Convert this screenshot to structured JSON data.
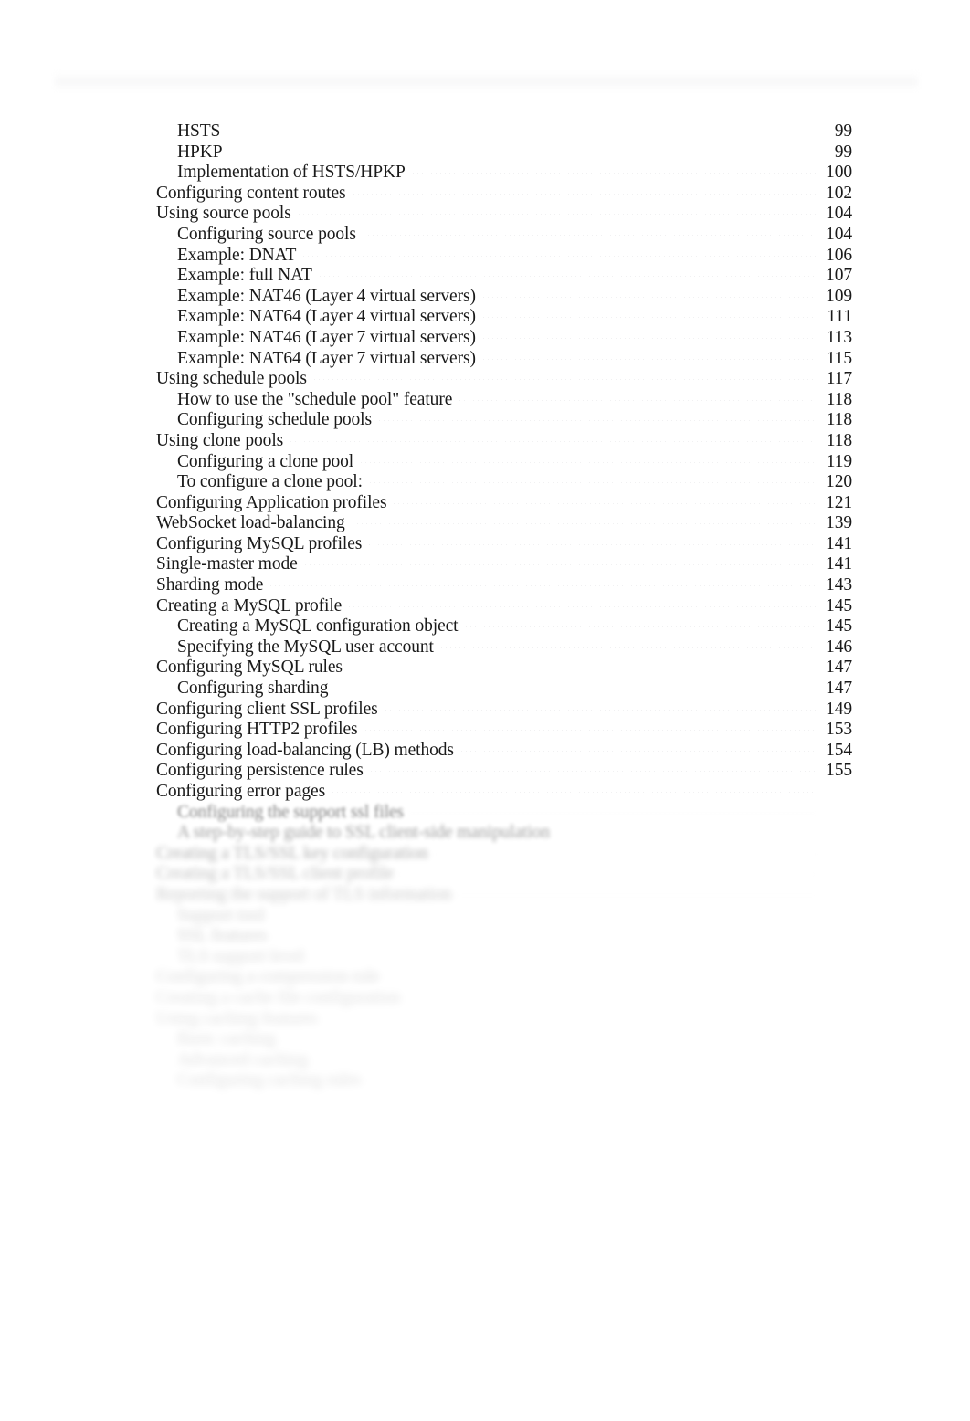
{
  "document": {
    "type": "table-of-contents",
    "running_header": "",
    "background_color": "#ffffff",
    "text_color": "#1a1a1a",
    "leader_dot_color": "#f1f1f2"
  },
  "toc": {
    "entries": [
      {
        "label": "HSTS",
        "page": "99",
        "level": 2,
        "blur": 0
      },
      {
        "label": "HPKP",
        "page": "99",
        "level": 2,
        "blur": 0
      },
      {
        "label": "Implementation of HSTS/HPKP",
        "page": "100",
        "level": 2,
        "blur": 0
      },
      {
        "label": "Configuring content routes",
        "page": "102",
        "level": 1,
        "blur": 0
      },
      {
        "label": "Using source pools",
        "page": "104",
        "level": 1,
        "blur": 0
      },
      {
        "label": "Configuring source pools",
        "page": "104",
        "level": 2,
        "blur": 0
      },
      {
        "label": "Example: DNAT",
        "page": "106",
        "level": 2,
        "blur": 0
      },
      {
        "label": "Example: full NAT",
        "page": "107",
        "level": 2,
        "blur": 0
      },
      {
        "label": "Example: NAT46 (Layer 4 virtual servers)",
        "page": "109",
        "level": 2,
        "blur": 0
      },
      {
        "label": "Example: NAT64 (Layer 4 virtual servers)",
        "page": "111",
        "level": 2,
        "blur": 0
      },
      {
        "label": "Example: NAT46 (Layer 7 virtual servers)",
        "page": "113",
        "level": 2,
        "blur": 0
      },
      {
        "label": "Example: NAT64 (Layer 7 virtual servers)",
        "page": "115",
        "level": 2,
        "blur": 0
      },
      {
        "label": "Using schedule pools",
        "page": "117",
        "level": 1,
        "blur": 0
      },
      {
        "label": "How to use the \"schedule pool\" feature",
        "page": "118",
        "level": 2,
        "blur": 0
      },
      {
        "label": "Configuring schedule pools",
        "page": "118",
        "level": 2,
        "blur": 0
      },
      {
        "label": "Using clone pools",
        "page": "118",
        "level": 1,
        "blur": 0
      },
      {
        "label": "Configuring a clone pool",
        "page": "119",
        "level": 2,
        "blur": 0
      },
      {
        "label": "To configure a clone pool:",
        "page": "120",
        "level": 2,
        "blur": 0
      },
      {
        "label": "Configuring Application profiles",
        "page": "121",
        "level": 1,
        "blur": 0
      },
      {
        "label": "WebSocket load-balancing",
        "page": "139",
        "level": 1,
        "blur": 0
      },
      {
        "label": "Configuring MySQL profiles",
        "page": "141",
        "level": 1,
        "blur": 0
      },
      {
        "label": "Single-master mode",
        "page": "141",
        "level": 1,
        "blur": 0
      },
      {
        "label": "Sharding mode",
        "page": "143",
        "level": 1,
        "blur": 0
      },
      {
        "label": "Creating a MySQL profile",
        "page": "145",
        "level": 1,
        "blur": 0
      },
      {
        "label": "Creating a MySQL configuration object",
        "page": "145",
        "level": 2,
        "blur": 0
      },
      {
        "label": "Specifying the MySQL user account",
        "page": "146",
        "level": 2,
        "blur": 0
      },
      {
        "label": "Configuring MySQL rules",
        "page": "147",
        "level": 1,
        "blur": 0
      },
      {
        "label": "Configuring sharding",
        "page": "147",
        "level": 2,
        "blur": 0
      },
      {
        "label": "Configuring client SSL profiles",
        "page": "149",
        "level": 1,
        "blur": 0
      },
      {
        "label": "Configuring HTTP2 profiles",
        "page": "153",
        "level": 1,
        "blur": 0
      },
      {
        "label": "Configuring load-balancing (LB) methods",
        "page": "154",
        "level": 1,
        "blur": 0
      },
      {
        "label": "Configuring persistence rules",
        "page": "155",
        "level": 1,
        "blur": 0
      },
      {
        "label": "Configuring error pages",
        "page": "",
        "level": 1,
        "blur": 0
      },
      {
        "label": "Configuring the support ssl files",
        "page": "",
        "level": 2,
        "blur": 1
      },
      {
        "label": "A step-by-step guide to SSL client-side manipulation",
        "page": "",
        "level": 2,
        "blur": 2
      },
      {
        "label": "Creating a TLS/SSL key configuration",
        "page": "",
        "level": 1,
        "blur": 3
      },
      {
        "label": "Creating a TLS/SSL client profile",
        "page": "",
        "level": 1,
        "blur": 4
      },
      {
        "label": "Reporting the support of TLS information",
        "page": "",
        "level": 1,
        "blur": 5
      },
      {
        "label": "Support tool",
        "page": "",
        "level": 2,
        "blur": 6
      },
      {
        "label": "SSL features",
        "page": "",
        "level": 2,
        "blur": 6
      },
      {
        "label": "TLS support level",
        "page": "",
        "level": 2,
        "blur": 7
      },
      {
        "label": "Configuring a compression rule",
        "page": "",
        "level": 1,
        "blur": 7
      },
      {
        "label": "Creating a cache file configuration",
        "page": "",
        "level": 1,
        "blur": 8
      },
      {
        "label": "Using caching features",
        "page": "",
        "level": 1,
        "blur": 8
      },
      {
        "label": "Basic caching",
        "page": "",
        "level": 2,
        "blur": 8
      },
      {
        "label": "Advanced caching",
        "page": "",
        "level": 2,
        "blur": 8
      },
      {
        "label": "Configuring caching rules",
        "page": "",
        "level": 2,
        "blur": 8
      }
    ]
  },
  "footer": {
    "line1": "",
    "line2": "",
    "page_number": ""
  }
}
